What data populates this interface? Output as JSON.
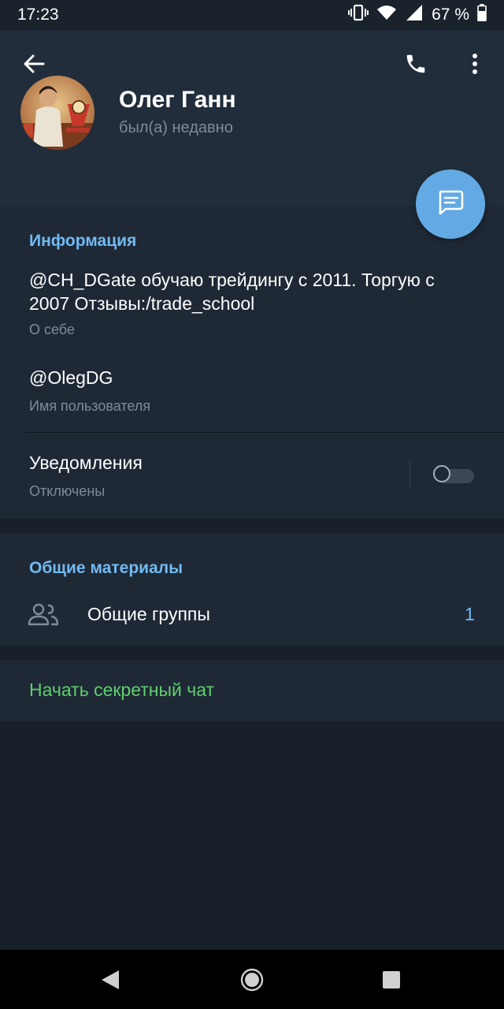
{
  "status_bar": {
    "time": "17:23",
    "battery": "67 %",
    "icons": [
      "vibrate-icon",
      "wifi-icon",
      "signal-icon",
      "battery-icon"
    ]
  },
  "header": {
    "icons": [
      "back-arrow-icon",
      "phone-icon",
      "more-vert-icon"
    ],
    "name": "Олег Ганн",
    "status": "был(а) недавно"
  },
  "fab": {
    "icon": "message-icon",
    "color": "#63a9e4"
  },
  "info": {
    "title": "Информация",
    "bio_line1": "@CH_DGate обучаю трейдингу с 2011. Торгую с",
    "bio_line2": "2007 Отзывы:/trade_school",
    "bio_label": "О себе",
    "username": "@OlegDG",
    "username_label": "Имя пользователя",
    "notifications_label": "Уведомления",
    "notifications_value": "Отключены",
    "notifications_on": false
  },
  "shared": {
    "title": "Общие материалы",
    "groups_label": "Общие группы",
    "groups_count": "1"
  },
  "secret_chat": {
    "label": "Начать секретный чат",
    "color": "#5fcf6d"
  },
  "colors": {
    "accent": "#71baf2",
    "header_bg": "#212d3b",
    "section_bg": "#1f2936",
    "page_bg": "#18202a"
  }
}
